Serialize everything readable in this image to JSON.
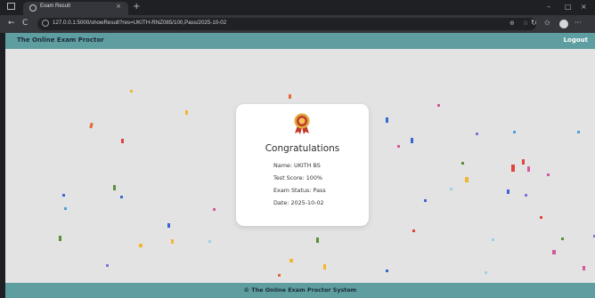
{
  "browser": {
    "tab_title": "Exam Result",
    "tab_close": "×",
    "new_tab": "+",
    "url": "127.0.0.1:5000/showResult?res=UKITH-RNZ085/100,Pass/2025-10-02",
    "nav": {
      "back": "←",
      "reload": "C"
    },
    "window": {
      "minimize": "–",
      "maximize": "□",
      "close": "×"
    },
    "toolbar": {
      "zoom": "⊕",
      "star": "☆",
      "sync": "↻",
      "favorites": "✩",
      "more": "···"
    }
  },
  "navbar": {
    "brand": "The Online Exam Proctor",
    "logout": "Logout"
  },
  "card": {
    "title": "Congratulations",
    "name": "Name: UKITH BS",
    "score": "Test Score: 100%",
    "status": "Exam Status: Pass",
    "date": "Date: 2025-10-02"
  },
  "footer": {
    "text": "© The Online Exam Proctor System"
  },
  "colors": {
    "navbar": "#5f9ea0",
    "page_bg": "#e3e3e3",
    "confetti": [
      "#e0443e",
      "#3a66d6",
      "#f2b630",
      "#8a6fd8",
      "#4aa3d6",
      "#5a8f3c",
      "#e7663a",
      "#d35a9a",
      "#9fd0e6"
    ]
  }
}
